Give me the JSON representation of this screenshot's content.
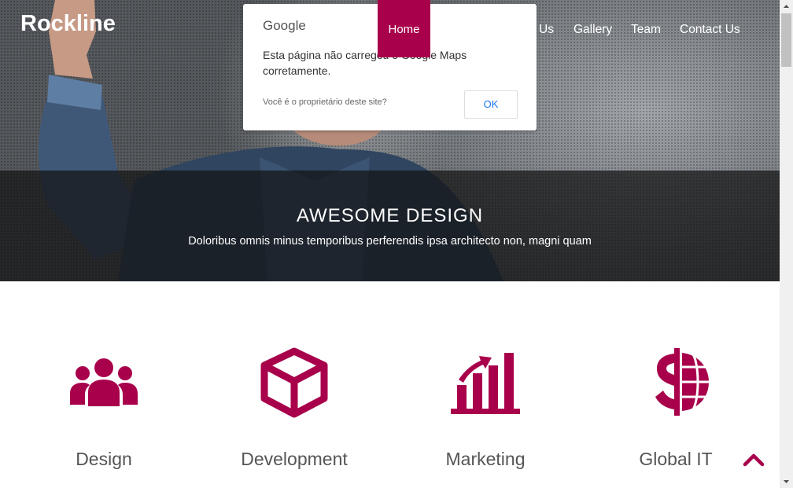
{
  "brand": "Rockline",
  "nav": {
    "active": "Home",
    "partial_hidden": "Us",
    "items": [
      "Gallery",
      "Team",
      "Contact Us"
    ]
  },
  "maps_dialog": {
    "logo": "Google",
    "message": "Esta página não carregou o Google Maps corretamente.",
    "question": "Você é o proprietário deste site?",
    "ok": "OK"
  },
  "hero": {
    "title": "AWESOME DESIGN",
    "subtitle": "Doloribus omnis minus temporibus perferendis ipsa architecto non, magni quam"
  },
  "features": [
    {
      "label": "Design",
      "icon": "users-icon"
    },
    {
      "label": "Development",
      "icon": "cube-icon"
    },
    {
      "label": "Marketing",
      "icon": "bar-chart-icon"
    },
    {
      "label": "Global IT",
      "icon": "dollar-globe-icon"
    }
  ],
  "colors": {
    "accent": "#a8004b"
  }
}
